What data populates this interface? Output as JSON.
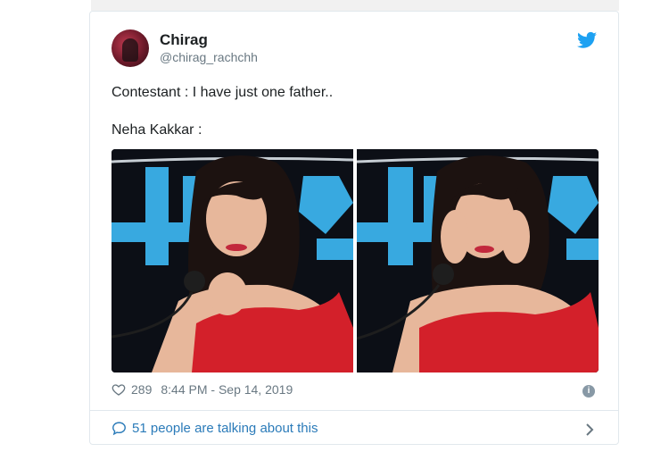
{
  "tweet": {
    "author_name": "Chirag",
    "author_handle": "@chirag_rachchh",
    "line1": "Contestant : I have just one father..",
    "line2": "Neha Kakkar :",
    "likes": "289",
    "timestamp": "8:44 PM - Sep 14, 2019",
    "conversation_text": "51 people are talking about this"
  },
  "icons": {
    "brand": "twitter-bird-icon",
    "like": "heart-icon",
    "info": "info-icon",
    "reply": "speech-bubble-icon",
    "chevron": "chevron-right-icon"
  },
  "colors": {
    "twitter_blue": "#1da1f2",
    "link_blue": "#2b7bb9",
    "muted_gray": "#697882",
    "stage_blue": "#38a9e0",
    "dress_red": "#d3202a"
  }
}
